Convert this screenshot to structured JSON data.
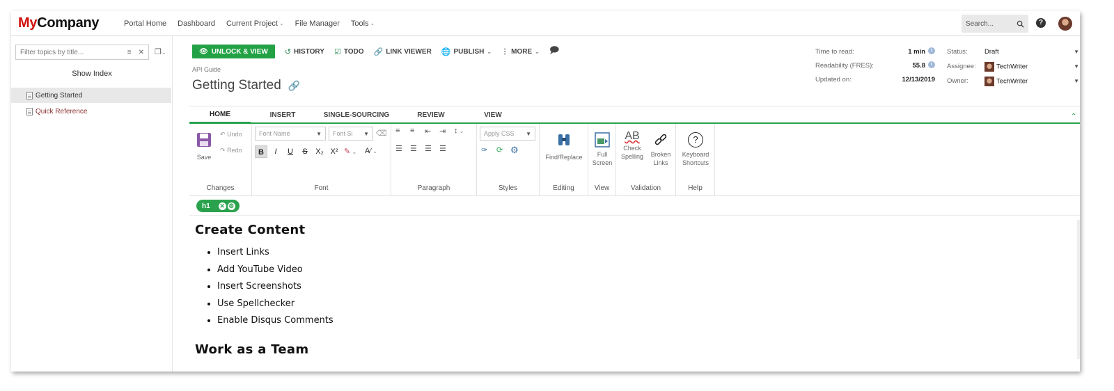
{
  "brand": {
    "part1": "My",
    "part2": "Company"
  },
  "nav": {
    "items": [
      {
        "label": "Portal Home",
        "has_menu": false
      },
      {
        "label": "Dashboard",
        "has_menu": false
      },
      {
        "label": "Current Project",
        "has_menu": true
      },
      {
        "label": "File Manager",
        "has_menu": false
      },
      {
        "label": "Tools",
        "has_menu": true
      }
    ],
    "search_placeholder": "Search...",
    "help_glyph": "?"
  },
  "sidebar": {
    "filter_placeholder": "Filter topics by title...",
    "show_index": "Show Index",
    "topics": [
      {
        "label": "Getting Started",
        "active": true
      },
      {
        "label": "Quick Reference",
        "active": false
      }
    ]
  },
  "actions": {
    "unlock": "UNLOCK & VIEW",
    "history": "HISTORY",
    "todo": "TODO",
    "link_viewer": "LINK VIEWER",
    "publish": "PUBLISH",
    "more": "MORE"
  },
  "document": {
    "breadcrumb": "API Guide",
    "title": "Getting Started"
  },
  "meta": {
    "time_to_read_label": "Time to read:",
    "time_to_read": "1 min",
    "readability_label": "Readability (FRES):",
    "readability": "55.8",
    "updated_label": "Updated on:",
    "updated": "12/13/2019",
    "status_label": "Status:",
    "status": "Draft",
    "assignee_label": "Assignee:",
    "assignee": "TechWriter",
    "owner_label": "Owner:",
    "owner": "TechWriter"
  },
  "tabs": [
    "HOME",
    "INSERT",
    "SINGLE-SOURCING",
    "REVIEW",
    "VIEW"
  ],
  "ribbon": {
    "changes": {
      "save": "Save",
      "undo": "Undo",
      "redo": "Redo",
      "label": "Changes"
    },
    "font": {
      "font_name": "Font Name",
      "font_size": "Font Si",
      "label": "Font",
      "buttons": [
        "B",
        "I",
        "U",
        "S",
        "X₂",
        "X²"
      ]
    },
    "paragraph": {
      "label": "Paragraph"
    },
    "styles": {
      "apply_css": "Apply CSS",
      "label": "Styles"
    },
    "editing": {
      "find_replace": "Find/Replace",
      "label": "Editing"
    },
    "view": {
      "full_screen_1": "Full",
      "full_screen_2": "Screen",
      "label": "View"
    },
    "validation": {
      "check_1": "Check",
      "check_2": "Spelling",
      "broken_1": "Broken",
      "broken_2": "Links",
      "ab": "AB",
      "label": "Validation"
    },
    "help": {
      "kb_1": "Keyboard",
      "kb_2": "Shortcuts",
      "glyph": "?",
      "label": "Help"
    }
  },
  "tag": {
    "name": "h1"
  },
  "content": {
    "heading1": "Create Content",
    "list": [
      "Insert Links",
      "Add YouTube Video",
      "Insert Screenshots",
      "Use Spellchecker",
      "Enable Disqus Comments"
    ],
    "heading2": "Work as a Team"
  }
}
